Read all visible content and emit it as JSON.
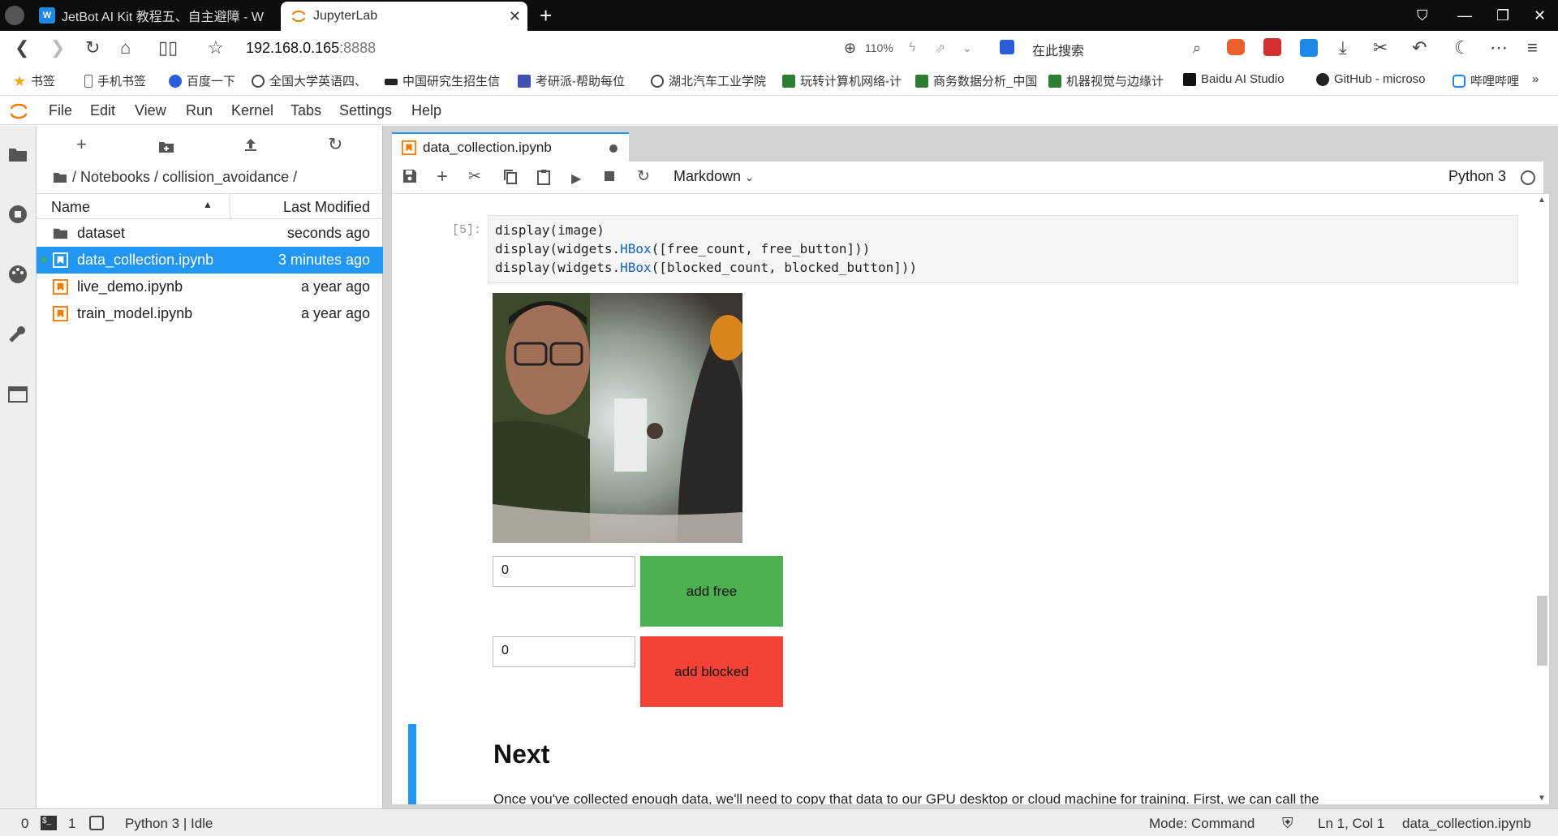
{
  "browser": {
    "tabs": [
      {
        "title": "JetBot AI Kit 教程五、自主避障 - W",
        "favicon": "W",
        "active": false
      },
      {
        "title": "JupyterLab",
        "favicon": "jupyter-icon",
        "active": true
      }
    ],
    "new_tab": "+",
    "url_host": "192.168.0.165",
    "url_port": ":8888",
    "zoom": "110%",
    "search_placeholder": "在此搜索"
  },
  "bookmarks": [
    {
      "label": "书签",
      "icon": "star-icon"
    },
    {
      "label": "手机书签",
      "icon": "phone-icon"
    },
    {
      "label": "百度一下",
      "icon": "baidu-icon"
    },
    {
      "label": "全国大学英语四、",
      "icon": "globe-icon"
    },
    {
      "label": "中国研究生招生信",
      "icon": "cap-icon"
    },
    {
      "label": "考研派-帮助每位",
      "icon": "kaoyan-icon"
    },
    {
      "label": "湖北汽车工业学院",
      "icon": "globe-icon"
    },
    {
      "label": "玩转计算机网络-计",
      "icon": "book-icon"
    },
    {
      "label": "商务数据分析_中国",
      "icon": "book-icon"
    },
    {
      "label": "机器视觉与边缘计",
      "icon": "book-icon"
    },
    {
      "label": "Baidu AI Studio",
      "icon": "ai-icon"
    },
    {
      "label": "GitHub - microso",
      "icon": "github-icon"
    },
    {
      "label": "哔哩哔哩",
      "icon": "bilibili-icon"
    }
  ],
  "menubar": [
    "File",
    "Edit",
    "View",
    "Run",
    "Kernel",
    "Tabs",
    "Settings",
    "Help"
  ],
  "filebrowser": {
    "breadcrumb": "/ Notebooks / collision_avoidance /",
    "col_name": "Name",
    "col_modified": "Last Modified",
    "files": [
      {
        "name": "dataset",
        "modified": "seconds ago",
        "type": "folder"
      },
      {
        "name": "data_collection.ipynb",
        "modified": "3 minutes ago",
        "type": "notebook",
        "selected": true
      },
      {
        "name": "live_demo.ipynb",
        "modified": "a year ago",
        "type": "notebook"
      },
      {
        "name": "train_model.ipynb",
        "modified": "a year ago",
        "type": "notebook"
      }
    ]
  },
  "notebook": {
    "tab_title": "data_collection.ipynb",
    "cell_type": "Markdown",
    "kernel": "Python 3",
    "prompt": "[5]:",
    "code_lines": [
      "display(image)",
      "display(widgets.HBox([free_count, free_button]))",
      "display(widgets.HBox([blocked_count, blocked_button]))"
    ],
    "free_count": "0",
    "free_button": "add free",
    "blocked_count": "0",
    "blocked_button": "add blocked",
    "next_heading": "Next",
    "next_paragraph": "Once you've collected enough data, we'll need to copy that data to our GPU desktop or cloud machine for training. First, we can call the"
  },
  "statusbar": {
    "left_count1": "0",
    "left_count2": "1",
    "kernel_status": "Python 3 | Idle",
    "mode": "Mode: Command",
    "position": "Ln 1, Col 1",
    "filename": "data_collection.ipynb"
  },
  "colors": {
    "accent": "#2196f3",
    "free_button": "#4caf50",
    "blocked_button": "#f44336",
    "notebook_icon": "#f57c00"
  }
}
